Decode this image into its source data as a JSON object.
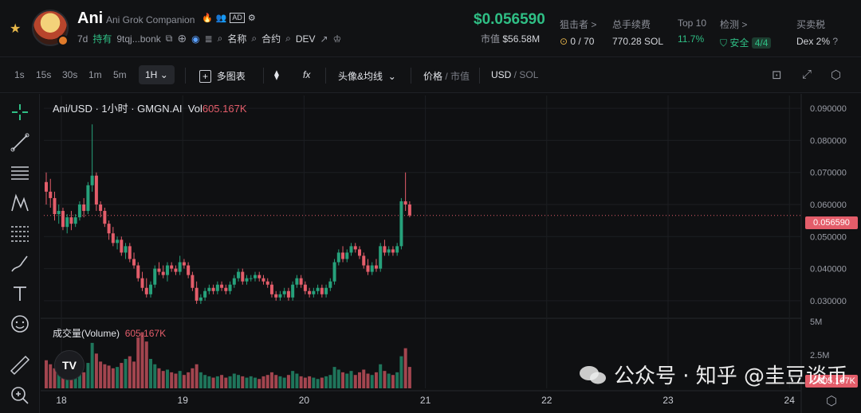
{
  "token": {
    "name": "Ani",
    "full_name": "Ani Grok Companion",
    "age": "7d",
    "holders_label": "持有",
    "address": "9tqj...bonk",
    "tools": [
      "名称",
      "合约",
      "DEV"
    ]
  },
  "market": {
    "price": "$0.056590",
    "mcap_label": "市值",
    "mcap_value": "$56.58M",
    "snipers_label": "狙击者 >",
    "snipers_value": "0 / 70",
    "fees_label": "总手续费",
    "fees_value": "770.28 SOL",
    "top10_label": "Top 10",
    "top10_value": "11.7%",
    "check_label": "检测 >",
    "check_value": "安全",
    "check_count": "4/4",
    "tax_label": "买卖税",
    "tax_value": "Dex 2%"
  },
  "toolbar": {
    "intervals": [
      "1s",
      "15s",
      "30s",
      "1m",
      "5m"
    ],
    "active_interval": "1H",
    "multi_chart": "多图表",
    "indicators": "头像&均线",
    "price_label": "价格",
    "mcap_label": "市值",
    "quote_usd": "USD",
    "quote_sol": "SOL"
  },
  "chart": {
    "legend_title": "Ani/USD · 1小时 · GMGN.AI",
    "vol_label": "Vol",
    "vol_value": "605.167K",
    "volume_label": "成交量(Volume)",
    "volume_value": "605.167K",
    "current_price": "0.056590",
    "current_volume": "605.167K",
    "tv_logo": "TV",
    "watermark": "公众号 · 知乎 @圭豆谈币"
  },
  "chart_data": {
    "type": "candlestick",
    "title": "Ani/USD · 1小时 · GMGN.AI",
    "y_ticks": [
      "0.090000",
      "0.080000",
      "0.070000",
      "0.060000",
      "0.050000",
      "0.040000",
      "0.030000"
    ],
    "ylim": [
      0.025,
      0.094
    ],
    "vol_ticks": [
      "5M",
      "2.5M"
    ],
    "vol_lim": [
      0,
      5000000
    ],
    "x_ticks": [
      "18",
      "19",
      "20",
      "21",
      "22",
      "23",
      "24"
    ],
    "colors": {
      "up": "#26a17b",
      "down": "#e35d6a",
      "grid": "#1c1e22",
      "axis_text": "#9a9da6"
    },
    "candles": [
      [
        0.067,
        0.07,
        0.06,
        0.064
      ],
      [
        0.064,
        0.068,
        0.059,
        0.062
      ],
      [
        0.062,
        0.064,
        0.055,
        0.057
      ],
      [
        0.057,
        0.06,
        0.054,
        0.058
      ],
      [
        0.058,
        0.059,
        0.052,
        0.053
      ],
      [
        0.053,
        0.057,
        0.051,
        0.056
      ],
      [
        0.056,
        0.058,
        0.052,
        0.054
      ],
      [
        0.054,
        0.057,
        0.053,
        0.056
      ],
      [
        0.056,
        0.061,
        0.055,
        0.06
      ],
      [
        0.06,
        0.062,
        0.056,
        0.058
      ],
      [
        0.058,
        0.067,
        0.057,
        0.066
      ],
      [
        0.066,
        0.085,
        0.064,
        0.069
      ],
      [
        0.069,
        0.07,
        0.058,
        0.06
      ],
      [
        0.06,
        0.061,
        0.056,
        0.058
      ],
      [
        0.058,
        0.059,
        0.053,
        0.054
      ],
      [
        0.054,
        0.055,
        0.049,
        0.051
      ],
      [
        0.051,
        0.053,
        0.047,
        0.048
      ],
      [
        0.048,
        0.05,
        0.046,
        0.049
      ],
      [
        0.049,
        0.05,
        0.044,
        0.045
      ],
      [
        0.045,
        0.048,
        0.043,
        0.047
      ],
      [
        0.047,
        0.048,
        0.042,
        0.043
      ],
      [
        0.043,
        0.045,
        0.04,
        0.041
      ],
      [
        0.041,
        0.042,
        0.036,
        0.037
      ],
      [
        0.037,
        0.039,
        0.033,
        0.034
      ],
      [
        0.034,
        0.037,
        0.031,
        0.032
      ],
      [
        0.032,
        0.036,
        0.031,
        0.035
      ],
      [
        0.035,
        0.041,
        0.034,
        0.04
      ],
      [
        0.04,
        0.042,
        0.038,
        0.039
      ],
      [
        0.039,
        0.041,
        0.037,
        0.038
      ],
      [
        0.038,
        0.042,
        0.036,
        0.041
      ],
      [
        0.041,
        0.042,
        0.039,
        0.04
      ],
      [
        0.04,
        0.041,
        0.038,
        0.039
      ],
      [
        0.039,
        0.044,
        0.038,
        0.042
      ],
      [
        0.042,
        0.043,
        0.04,
        0.041
      ],
      [
        0.041,
        0.042,
        0.037,
        0.038
      ],
      [
        0.038,
        0.039,
        0.033,
        0.034
      ],
      [
        0.034,
        0.036,
        0.029,
        0.03
      ],
      [
        0.03,
        0.032,
        0.029,
        0.031
      ],
      [
        0.031,
        0.034,
        0.03,
        0.033
      ],
      [
        0.033,
        0.035,
        0.032,
        0.034
      ],
      [
        0.034,
        0.035,
        0.032,
        0.033
      ],
      [
        0.033,
        0.036,
        0.032,
        0.035
      ],
      [
        0.035,
        0.036,
        0.033,
        0.034
      ],
      [
        0.034,
        0.035,
        0.032,
        0.033
      ],
      [
        0.033,
        0.036,
        0.032,
        0.035
      ],
      [
        0.035,
        0.038,
        0.034,
        0.037
      ],
      [
        0.037,
        0.04,
        0.036,
        0.039
      ],
      [
        0.039,
        0.04,
        0.035,
        0.036
      ],
      [
        0.036,
        0.038,
        0.035,
        0.037
      ],
      [
        0.037,
        0.038,
        0.036,
        0.037
      ],
      [
        0.037,
        0.039,
        0.036,
        0.038
      ],
      [
        0.038,
        0.039,
        0.036,
        0.037
      ],
      [
        0.037,
        0.038,
        0.035,
        0.036
      ],
      [
        0.036,
        0.037,
        0.034,
        0.035
      ],
      [
        0.035,
        0.036,
        0.031,
        0.032
      ],
      [
        0.032,
        0.033,
        0.03,
        0.031
      ],
      [
        0.031,
        0.033,
        0.03,
        0.032
      ],
      [
        0.032,
        0.034,
        0.031,
        0.033
      ],
      [
        0.033,
        0.034,
        0.03,
        0.031
      ],
      [
        0.031,
        0.036,
        0.03,
        0.035
      ],
      [
        0.035,
        0.038,
        0.034,
        0.037
      ],
      [
        0.037,
        0.038,
        0.034,
        0.035
      ],
      [
        0.035,
        0.036,
        0.032,
        0.033
      ],
      [
        0.033,
        0.034,
        0.031,
        0.032
      ],
      [
        0.032,
        0.034,
        0.031,
        0.033
      ],
      [
        0.033,
        0.035,
        0.032,
        0.034
      ],
      [
        0.034,
        0.035,
        0.031,
        0.032
      ],
      [
        0.032,
        0.035,
        0.031,
        0.034
      ],
      [
        0.034,
        0.037,
        0.033,
        0.036
      ],
      [
        0.036,
        0.043,
        0.035,
        0.042
      ],
      [
        0.042,
        0.046,
        0.041,
        0.045
      ],
      [
        0.045,
        0.047,
        0.042,
        0.043
      ],
      [
        0.043,
        0.046,
        0.042,
        0.045
      ],
      [
        0.045,
        0.048,
        0.044,
        0.047
      ],
      [
        0.047,
        0.048,
        0.045,
        0.046
      ],
      [
        0.046,
        0.047,
        0.043,
        0.044
      ],
      [
        0.044,
        0.045,
        0.04,
        0.041
      ],
      [
        0.041,
        0.043,
        0.038,
        0.039
      ],
      [
        0.039,
        0.042,
        0.038,
        0.041
      ],
      [
        0.041,
        0.043,
        0.039,
        0.04
      ],
      [
        0.04,
        0.048,
        0.039,
        0.047
      ],
      [
        0.047,
        0.049,
        0.044,
        0.045
      ],
      [
        0.045,
        0.047,
        0.044,
        0.046
      ],
      [
        0.046,
        0.047,
        0.044,
        0.045
      ],
      [
        0.045,
        0.048,
        0.044,
        0.047
      ],
      [
        0.047,
        0.062,
        0.046,
        0.061
      ],
      [
        0.061,
        0.07,
        0.058,
        0.06
      ],
      [
        0.06,
        0.061,
        0.056,
        0.0566
      ]
    ],
    "volumes": [
      2.1,
      1.8,
      1.5,
      1.2,
      1.4,
      1.1,
      0.9,
      1.0,
      1.3,
      1.2,
      1.9,
      3.4,
      2.6,
      2.0,
      1.8,
      1.7,
      1.5,
      1.6,
      1.9,
      2.2,
      2.4,
      2.0,
      3.8,
      4.2,
      3.5,
      2.2,
      1.8,
      1.5,
      1.3,
      1.4,
      1.2,
      1.1,
      1.3,
      1.0,
      1.2,
      1.5,
      1.8,
      1.2,
      1.0,
      0.9,
      0.8,
      0.9,
      1.0,
      0.8,
      0.9,
      1.1,
      1.0,
      0.9,
      0.8,
      0.9,
      0.8,
      0.7,
      0.9,
      1.0,
      1.2,
      1.0,
      0.9,
      0.8,
      1.0,
      1.3,
      1.1,
      0.9,
      0.8,
      0.9,
      0.8,
      0.7,
      0.8,
      0.9,
      1.0,
      1.6,
      1.4,
      1.2,
      1.1,
      1.3,
      1.0,
      1.2,
      1.4,
      1.1,
      1.0,
      1.2,
      1.8,
      1.3,
      1.1,
      1.0,
      1.2,
      2.4,
      3.0,
      1.6
    ]
  }
}
